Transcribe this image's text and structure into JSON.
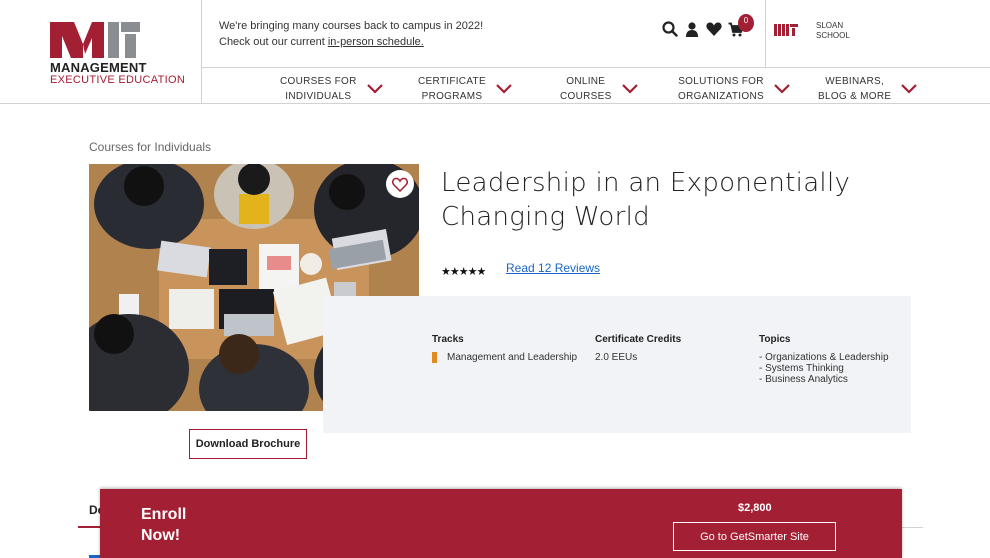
{
  "header": {
    "logo_main": "MANAGEMENT",
    "logo_sub": "EXECUTIVE EDUCATION",
    "announcement_line1": "We're bringing many courses back to campus in 2022!",
    "announcement_prefix": "Check out our current ",
    "announcement_link": "in-person schedule.",
    "cart_count": "0",
    "sloan_line1": "SLOAN",
    "sloan_line2": "SCHOOL"
  },
  "nav": [
    {
      "line1": "COURSES FOR",
      "line2": "INDIVIDUALS"
    },
    {
      "line1": "CERTIFICATE",
      "line2": "PROGRAMS"
    },
    {
      "line1": "ONLINE",
      "line2": "COURSES"
    },
    {
      "line1": "SOLUTIONS FOR",
      "line2": "ORGANIZATIONS"
    },
    {
      "line1": "WEBINARS,",
      "line2": "BLOG & MORE"
    }
  ],
  "breadcrumb": "Courses for Individuals",
  "course": {
    "title": "Leadership in an Exponentially Changing World",
    "rating_stars": "★★★★★",
    "reviews_link": "Read 12 Reviews"
  },
  "info": {
    "tracks_heading": "Tracks",
    "track": "Management and Leadership",
    "credits_heading": "Certificate Credits",
    "credits": "2.0 EEUs",
    "topics_heading": "Topics",
    "topics": [
      "- Organizations & Leadership",
      "- Systems Thinking",
      "- Business Analytics"
    ]
  },
  "brochure_button": "Download Brochure",
  "tab_fragment": "De",
  "enroll": {
    "label": "Enroll Now!",
    "price": "$2,800",
    "button": "Go to GetSmarter Site"
  },
  "colors": {
    "brand": "#a31f34",
    "link": "#1a66c4",
    "track": "#e28a1f"
  }
}
